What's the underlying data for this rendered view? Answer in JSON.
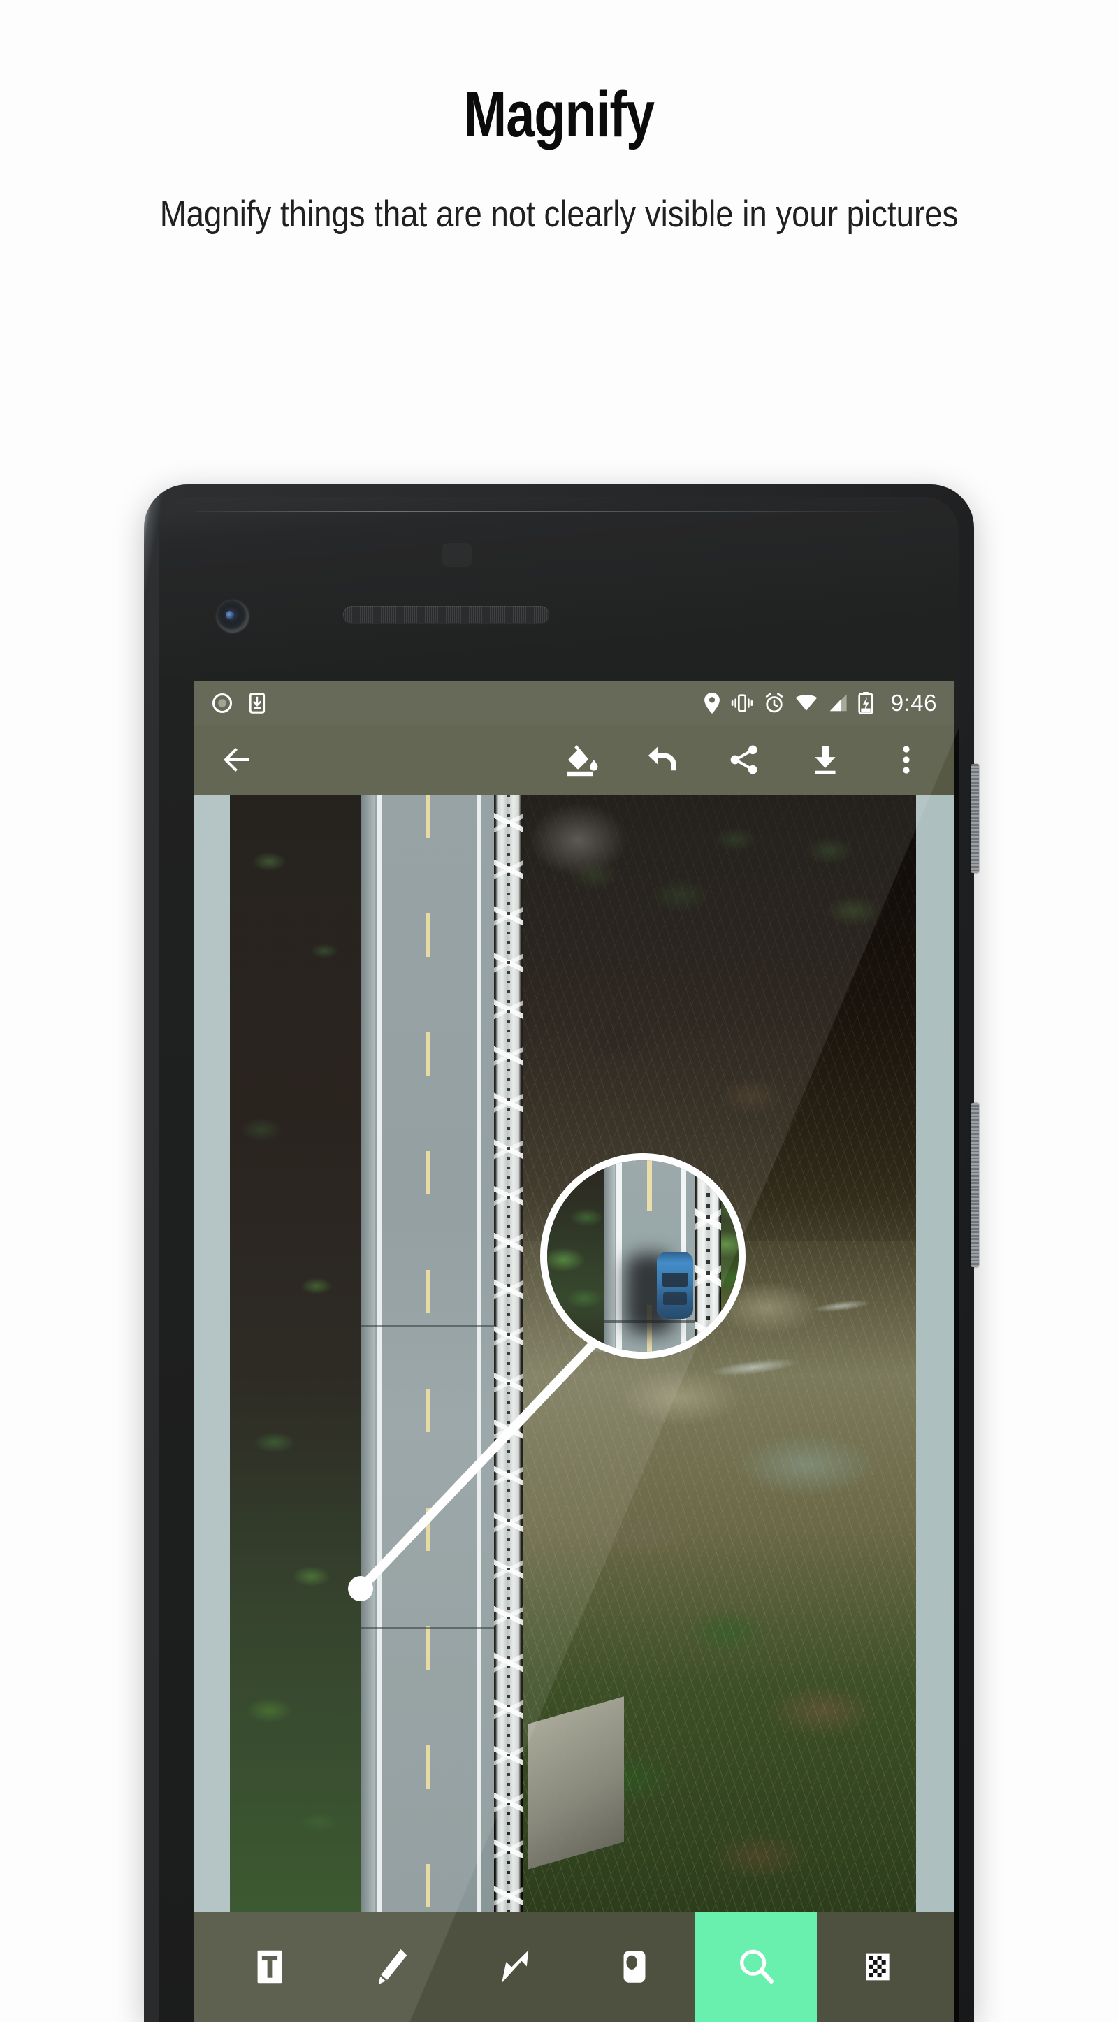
{
  "promo": {
    "title": "Magnify",
    "subtitle": "Magnify things that are not clearly visible in your pictures"
  },
  "colors": {
    "page_background": "#fdfdfd",
    "status_bar": "#5a5c49",
    "toolbar": "#575945",
    "tool_strip": "#4f5140",
    "accent_active": "#69f0ae",
    "letterbox": "#aebfbf",
    "icon": "#ffffff"
  },
  "phone": {
    "hardware": [
      {
        "name": "front-camera",
        "label": "Front camera"
      },
      {
        "name": "earpiece-speaker",
        "label": "Earpiece speaker"
      },
      {
        "name": "proximity-sensor",
        "label": "Proximity sensor"
      },
      {
        "name": "power-button",
        "label": "Power"
      },
      {
        "name": "volume-button",
        "label": "Volume"
      }
    ]
  },
  "status_bar": {
    "time": "9:46",
    "left_icons": [
      {
        "name": "screen-record-icon",
        "label": "Screen recording"
      },
      {
        "name": "download-to-device-icon",
        "label": "Download to device"
      }
    ],
    "right_icons": [
      {
        "name": "location-pin-icon",
        "label": "Location"
      },
      {
        "name": "vibrate-icon",
        "label": "Vibrate"
      },
      {
        "name": "alarm-icon",
        "label": "Alarm set"
      },
      {
        "name": "wifi-icon",
        "label": "Wi-Fi"
      },
      {
        "name": "cell-signal-icon",
        "label": "Cellular signal"
      },
      {
        "name": "battery-charging-icon",
        "label": "Battery charging"
      }
    ]
  },
  "toolbar": {
    "back": {
      "name": "back-button",
      "label": "Back"
    },
    "actions": [
      {
        "name": "fill-color-button",
        "label": "Fill color"
      },
      {
        "name": "undo-button",
        "label": "Undo"
      },
      {
        "name": "share-button",
        "label": "Share"
      },
      {
        "name": "save-button",
        "label": "Save"
      },
      {
        "name": "more-options-button",
        "label": "More options"
      }
    ]
  },
  "canvas": {
    "photo_description": "Aerial top-down photo of a highway bridge with white steel truss crossing a forested river ravine",
    "magnifier": {
      "name": "magnifier-annotation",
      "zoom_subject": "Blue car on the bridge roadway",
      "border_color": "#ffffff"
    },
    "anchor": {
      "name": "magnifier-anchor-dot"
    }
  },
  "tools": [
    {
      "name": "tool-text",
      "label": "Text",
      "active": false
    },
    {
      "name": "tool-draw",
      "label": "Draw",
      "active": false
    },
    {
      "name": "tool-arrow",
      "label": "Arrow",
      "active": false
    },
    {
      "name": "tool-shape",
      "label": "Shape",
      "active": false
    },
    {
      "name": "tool-magnify",
      "label": "Magnify",
      "active": true
    },
    {
      "name": "tool-pixelate",
      "label": "Pixelate",
      "active": false
    }
  ]
}
